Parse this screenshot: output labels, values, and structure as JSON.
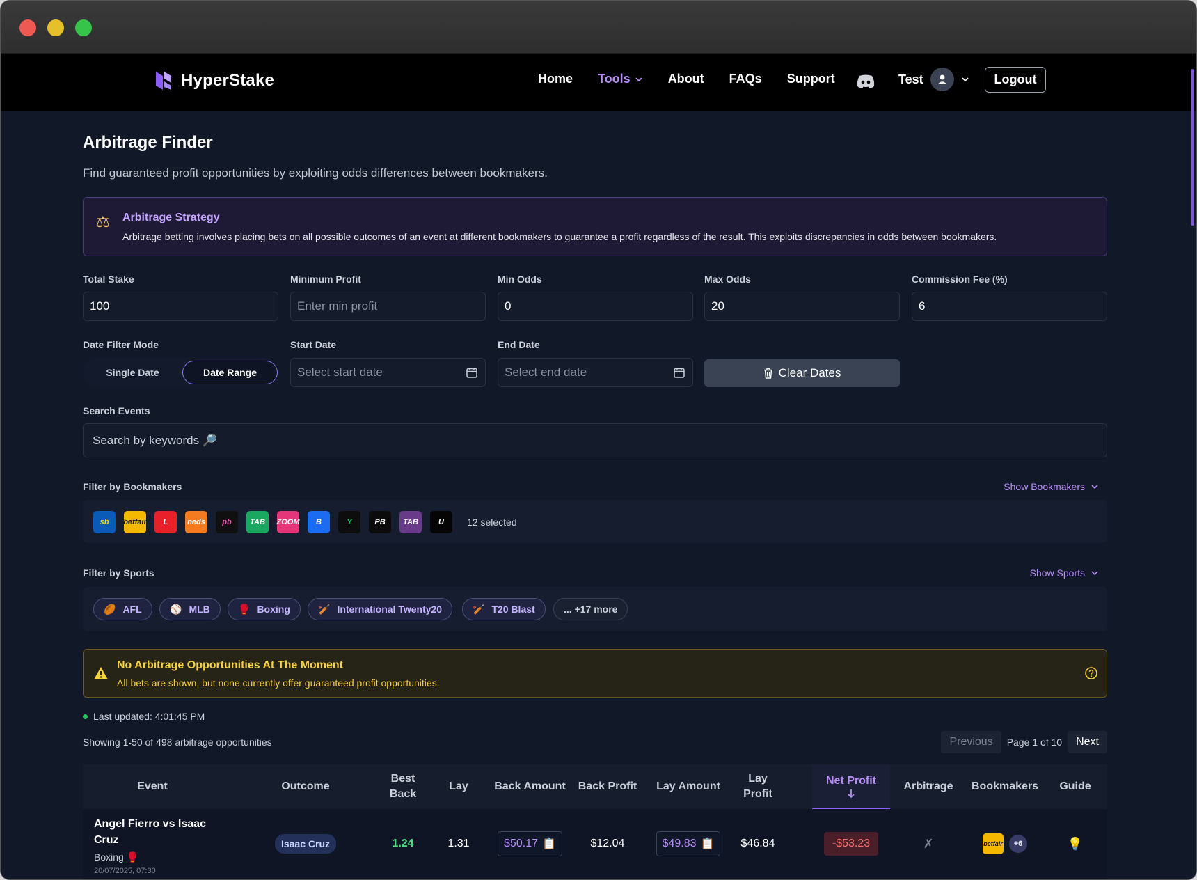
{
  "app": {
    "brand": "HyperStake",
    "nav": {
      "home": "Home",
      "tools": "Tools",
      "about": "About",
      "faqs": "FAQs",
      "support": "Support"
    },
    "user": "Test",
    "logout": "Logout"
  },
  "page": {
    "title": "Arbitrage Finder",
    "subtitle": "Find guaranteed profit opportunities by exploiting odds differences between bookmakers."
  },
  "strategy": {
    "title": "Arbitrage Strategy",
    "text": "Arbitrage betting involves placing bets on all possible outcomes of an event at different bookmakers to guarantee a profit regardless of the result. This exploits discrepancies in odds between bookmakers."
  },
  "filters": {
    "total_stake": {
      "label": "Total Stake",
      "value": "100"
    },
    "min_profit": {
      "label": "Minimum Profit",
      "placeholder": "Enter min profit"
    },
    "min_odds": {
      "label": "Min Odds",
      "value": "0"
    },
    "max_odds": {
      "label": "Max Odds",
      "value": "20"
    },
    "commission": {
      "label": "Commission Fee (%)",
      "value": "6"
    },
    "date_mode": {
      "label": "Date Filter Mode",
      "single": "Single Date",
      "range": "Date Range",
      "selected": "Date Range"
    },
    "start_date": {
      "label": "Start Date",
      "placeholder": "Select start date"
    },
    "end_date": {
      "label": "End Date",
      "placeholder": "Select end date"
    },
    "clear_dates": "Clear Dates",
    "search": {
      "label": "Search Events",
      "placeholder": "Search by keywords 🔎"
    }
  },
  "bookmakers": {
    "label": "Filter by Bookmakers",
    "toggle": "Show Bookmakers",
    "selected": "12 selected",
    "logos": [
      {
        "text": "sb",
        "bg": "#0a5bb8",
        "fg": "#f5d700"
      },
      {
        "text": "betfair",
        "bg": "#f5b800",
        "fg": "#111"
      },
      {
        "text": "L",
        "bg": "#e8202a",
        "fg": "#fff"
      },
      {
        "text": "neds",
        "bg": "#f47b20",
        "fg": "#fff"
      },
      {
        "text": "pb",
        "bg": "#101010",
        "fg": "#f15cb4"
      },
      {
        "text": "TAB",
        "bg": "#1aa861",
        "fg": "#fff"
      },
      {
        "text": "ZOOM",
        "bg": "#e5367a",
        "fg": "#fff"
      },
      {
        "text": "B",
        "bg": "#1b6cf0",
        "fg": "#fff"
      },
      {
        "text": "Y",
        "bg": "#0d0d0d",
        "fg": "#28d77a"
      },
      {
        "text": "PB",
        "bg": "#0b0b0b",
        "fg": "#fff"
      },
      {
        "text": "TAB",
        "bg": "#6a3a8a",
        "fg": "#fff"
      },
      {
        "text": "U",
        "bg": "#050505",
        "fg": "#fff"
      }
    ]
  },
  "sports": {
    "label": "Filter by Sports",
    "toggle": "Show Sports",
    "chips": [
      {
        "label": "AFL",
        "icon": "🏉"
      },
      {
        "label": "MLB",
        "icon": "⚾"
      },
      {
        "label": "Boxing",
        "icon": "🥊"
      },
      {
        "label": "International Twenty20",
        "icon": "🏏"
      },
      {
        "label": "T20 Blast",
        "icon": "🏏"
      }
    ],
    "more": "... +17 more"
  },
  "alert": {
    "title": "No Arbitrage Opportunities At The Moment",
    "text": "All bets are shown, but none currently offer guaranteed profit opportunities."
  },
  "status": {
    "last_updated": "Last updated: 4:01:45 PM",
    "showing": "Showing 1-50 of 498 arbitrage opportunities",
    "previous": "Previous",
    "page": "Page 1 of 10",
    "next": "Next"
  },
  "table": {
    "headers": {
      "event": "Event",
      "outcome": "Outcome",
      "best_back": "Best Back",
      "lay": "Lay",
      "back_amount": "Back Amount",
      "back_profit": "Back Profit",
      "lay_amount": "Lay Amount",
      "lay_profit": "Lay Profit",
      "net_profit": "Net Profit",
      "arbitrage": "Arbitrage",
      "bookmakers": "Bookmakers",
      "guide": "Guide"
    },
    "rows": [
      {
        "event": "Angel Fierro vs Isaac Cruz",
        "sport": "Boxing 🥊",
        "date": "20/07/2025, 07:30",
        "outcome": "Isaac Cruz",
        "best_back": "1.24",
        "lay": "1.31",
        "back_amount": "$50.17",
        "back_profit": "$12.04",
        "lay_amount": "$49.83",
        "lay_profit": "$46.84",
        "net_profit": "-$53.23",
        "arbitrage": "✗",
        "bm_more": "+6"
      }
    ]
  },
  "colors": {
    "accent": "#b68cf5",
    "warning": "#f6d23d",
    "success": "#22c55e",
    "danger": "#f87171"
  }
}
